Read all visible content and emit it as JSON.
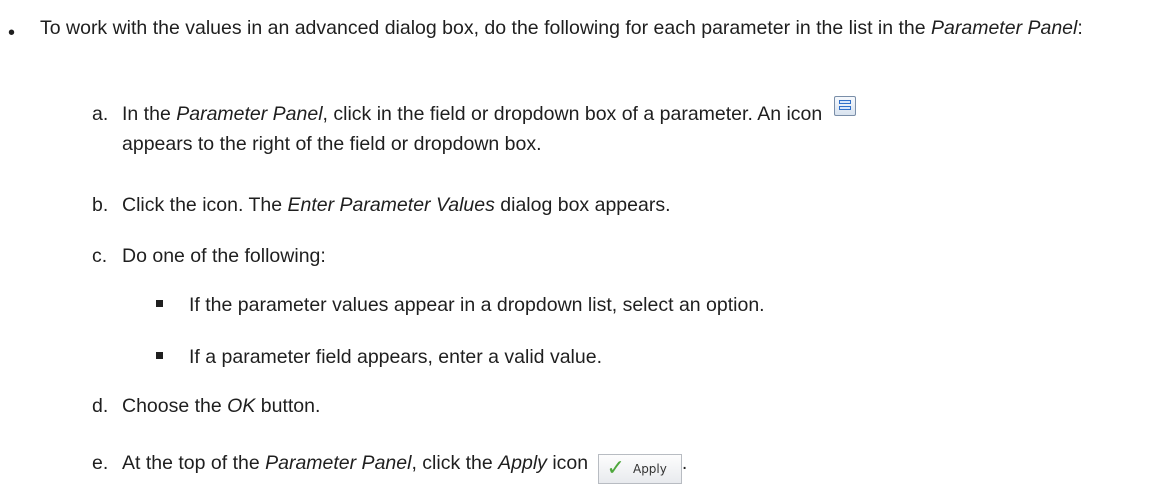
{
  "intro": {
    "bullet": "•",
    "text_1": "To work with the values in an advanced dialog box, do the following for each parameter in the list in the ",
    "italic_1": "Parameter Panel",
    "text_2": ":"
  },
  "steps": {
    "a": {
      "marker": "a.",
      "text_1": "In the ",
      "italic_1": "Parameter Panel",
      "text_2": ", click in the field or dropdown box of a parameter. An icon",
      "icon": "parameter-values-icon",
      "line_2": "appears to the right of the field or dropdown box."
    },
    "b": {
      "marker": "b.",
      "text_1": "Click the icon. The ",
      "italic_1": "Enter Parameter Values",
      "text_2": " dialog box appears."
    },
    "c": {
      "marker": "c.",
      "text": "Do one of the following:",
      "options": [
        "If the parameter values appear in a dropdown list, select an option.",
        "If a parameter field appears, enter a valid value."
      ]
    },
    "d": {
      "marker": "d.",
      "text_1": "Choose the ",
      "italic_1": "OK",
      "text_2": " button."
    },
    "e": {
      "marker": "e.",
      "text_1": "At the top of the ",
      "italic_1": "Parameter Panel",
      "text_2": ", click the ",
      "italic_2": "Apply",
      "text_3": " icon",
      "button_label": "Apply",
      "text_4": "."
    }
  },
  "colors": {
    "text": "#1f1f1f",
    "apply_check": "#4ea73c",
    "icon_blue": "#2f6fc9"
  }
}
